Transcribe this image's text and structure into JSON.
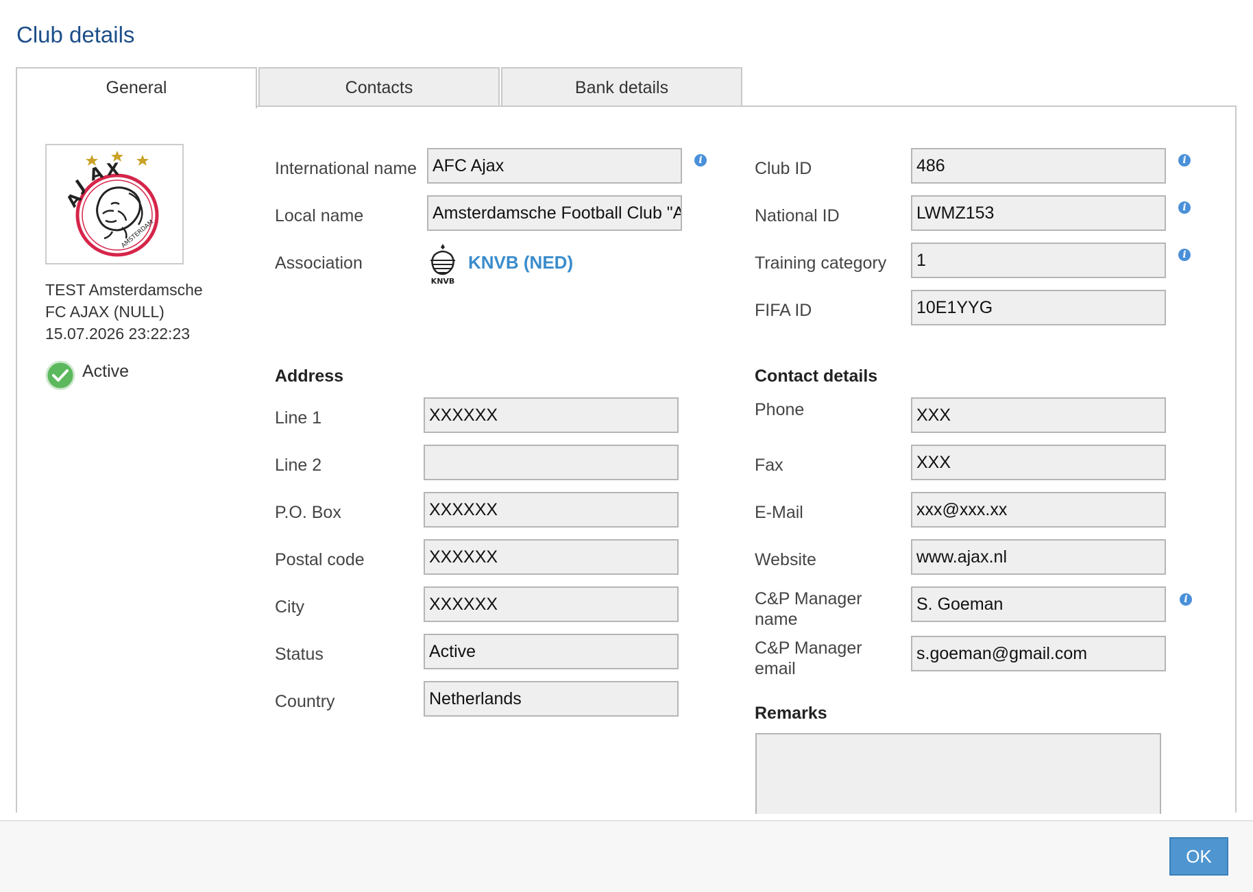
{
  "dialog": {
    "title": "Club details"
  },
  "tabs": [
    {
      "label": "General"
    },
    {
      "label": "Contacts"
    },
    {
      "label": "Bank details"
    }
  ],
  "club": {
    "name_line1": "TEST Amsterdamsche",
    "name_line2": "FC AJAX (NULL)",
    "timestamp": "15.07.2026 23:22:23",
    "status": "Active",
    "logo_icon": "ajax-logo-icon"
  },
  "general": {
    "international_name": {
      "label": "International name",
      "value": "AFC Ajax"
    },
    "local_name": {
      "label": "Local name",
      "value": "Amsterdamsche Football Club \"Ajax\""
    },
    "association": {
      "label": "Association",
      "value": "KNVB (NED)",
      "logo_text": "KNVB"
    },
    "club_id": {
      "label": "Club ID",
      "value": "486"
    },
    "national_id": {
      "label": "National ID",
      "value": "LWMZ153"
    },
    "training_category": {
      "label": "Training category",
      "value": "1"
    },
    "fifa_id": {
      "label": "FIFA ID",
      "value": "10E1YYG"
    }
  },
  "address": {
    "heading": "Address",
    "line1": {
      "label": "Line 1",
      "value": "XXXXXX"
    },
    "line2": {
      "label": "Line 2",
      "value": ""
    },
    "po_box": {
      "label": "P.O. Box",
      "value": "XXXXXX"
    },
    "postal_code": {
      "label": "Postal code",
      "value": "XXXXXX"
    },
    "city": {
      "label": "City",
      "value": "XXXXXX"
    },
    "status": {
      "label": "Status",
      "value": "Active"
    },
    "country": {
      "label": "Country",
      "value": "Netherlands"
    }
  },
  "contact": {
    "heading": "Contact details",
    "phone": {
      "label": "Phone",
      "value": "XXX"
    },
    "fax": {
      "label": "Fax",
      "value": "XXX"
    },
    "email": {
      "label": "E-Mail",
      "value": "xxx@xxx.xx"
    },
    "website": {
      "label": "Website",
      "value": "www.ajax.nl"
    },
    "cp_manager_name": {
      "label_line1": "C&P Manager",
      "label_line2": "name",
      "value": "S. Goeman"
    },
    "cp_manager_email": {
      "label_line1": "C&P Manager",
      "label_line2": "email",
      "value": "s.goeman@gmail.com"
    }
  },
  "remarks": {
    "heading": "Remarks",
    "value": ""
  },
  "footer": {
    "ok_label": "OK"
  },
  "colors": {
    "title": "#1d4e89",
    "link": "#3a8ccc",
    "info_icon": "#4a90d9",
    "ok_button": "#4f96d0",
    "status_active": "#5cb85c"
  }
}
